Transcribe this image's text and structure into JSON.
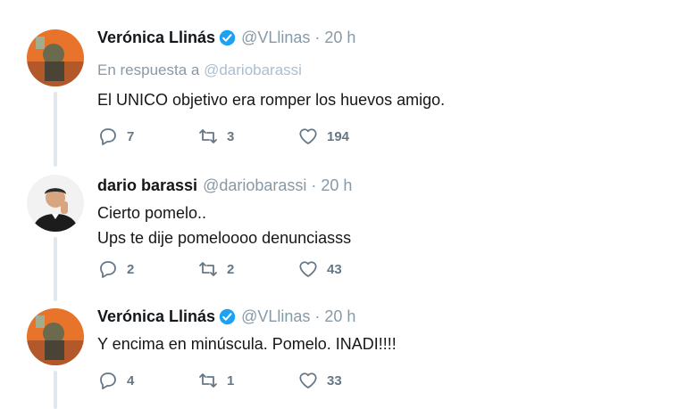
{
  "tweets": [
    {
      "name": "Verónica Llinás",
      "verified": true,
      "handle": "@VLlinas",
      "separator": "·",
      "time": "20 h",
      "reply_prefix": "En respuesta a",
      "reply_handle": "@dariobarassi",
      "lines": [
        "El UNICO objetivo era romper los huevos amigo."
      ],
      "replies": "7",
      "retweets": "3",
      "likes": "194",
      "avatar_colors": [
        "#e8742b",
        "#b3582a",
        "#6b6a4c"
      ]
    },
    {
      "name": "dario barassi",
      "verified": false,
      "handle": "@dariobarassi",
      "separator": "·",
      "time": "20 h",
      "lines": [
        "Cierto pomelo..",
        "Ups te dije pomeloooo denunciasss"
      ],
      "replies": "2",
      "retweets": "2",
      "likes": "43",
      "avatar_colors": [
        "#f2f2f2",
        "#1c1c1c",
        "#2b2b2b"
      ]
    },
    {
      "name": "Verónica Llinás",
      "verified": true,
      "handle": "@VLlinas",
      "separator": "·",
      "time": "20 h",
      "lines": [
        "Y encima en minúscula. Pomelo. INADI!!!!"
      ],
      "replies": "4",
      "retweets": "1",
      "likes": "33",
      "avatar_colors": [
        "#e8742b",
        "#b3582a",
        "#6b6a4c"
      ]
    }
  ],
  "icons": {
    "reply": "reply-icon",
    "retweet": "retweet-icon",
    "like": "heart-icon",
    "verified": "verified-badge-icon"
  },
  "colors": {
    "muted": "#8899a6",
    "verified": "#1da1f2",
    "thread_line": "#e1e8ed",
    "action": "#657786"
  }
}
